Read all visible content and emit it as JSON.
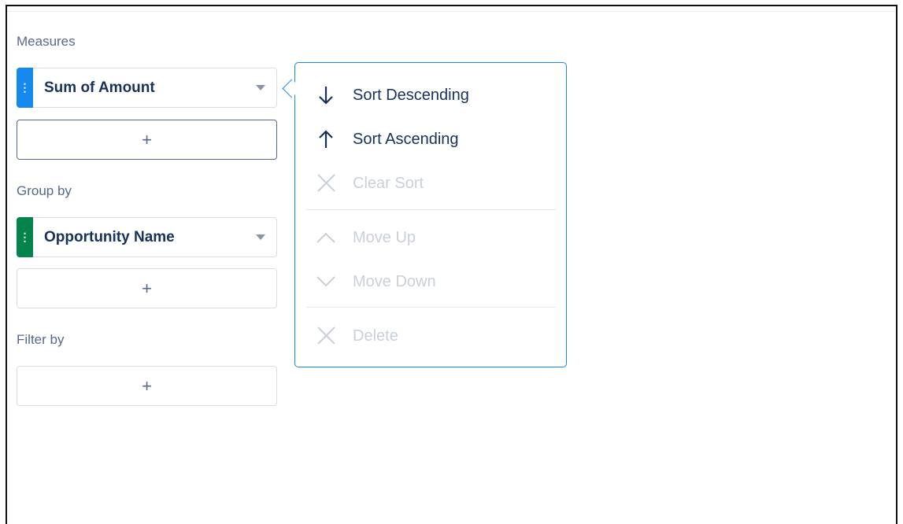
{
  "sections": {
    "measures": {
      "label": "Measures",
      "field": "Sum of Amount",
      "add": "+"
    },
    "group_by": {
      "label": "Group by",
      "field": "Opportunity Name",
      "add": "+"
    },
    "filter_by": {
      "label": "Filter by",
      "add": "+"
    }
  },
  "grip_glyph": "⋮",
  "menu": {
    "items": [
      {
        "label": "Sort Descending",
        "icon": "arrow-down-icon",
        "enabled": true
      },
      {
        "label": "Sort Ascending",
        "icon": "arrow-up-icon",
        "enabled": true
      },
      {
        "label": "Clear Sort",
        "icon": "close-icon",
        "enabled": false
      },
      {
        "label": "Move Up",
        "icon": "chevron-up-icon",
        "enabled": false
      },
      {
        "label": "Move Down",
        "icon": "chevron-down-icon",
        "enabled": false
      },
      {
        "label": "Delete",
        "icon": "close-icon",
        "enabled": false
      }
    ]
  },
  "colors": {
    "measure_accent": "#1589ee",
    "group_accent": "#04844b",
    "popover_border": "#1589ee",
    "text_primary": "#16325c",
    "text_label": "#54698d",
    "text_disabled": "#c9d0da"
  }
}
